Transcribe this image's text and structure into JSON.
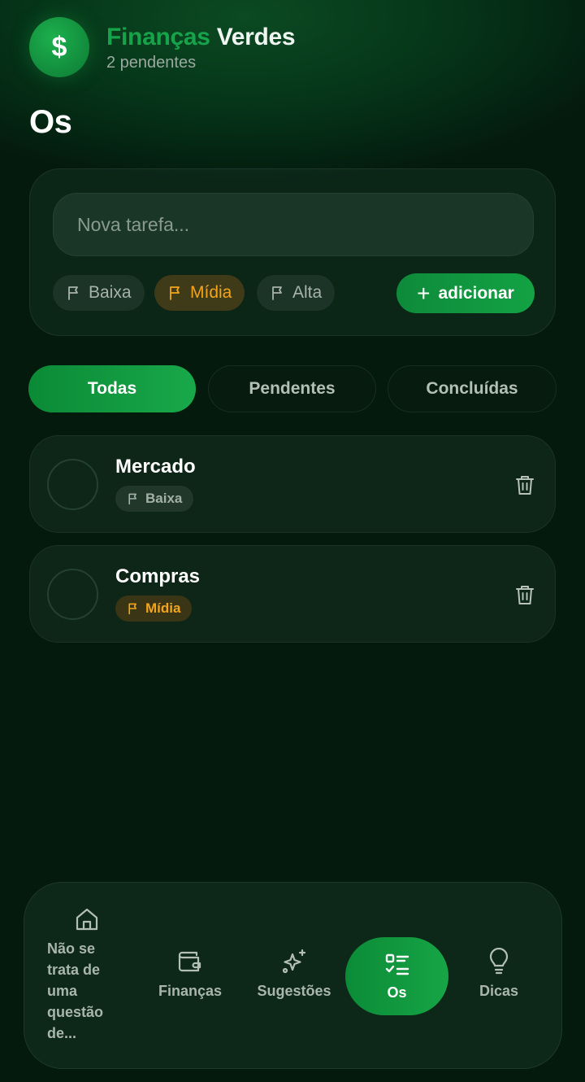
{
  "header": {
    "brand_part1": "Finanças",
    "brand_part2": "Verdes",
    "subtitle": "2 pendentes",
    "logo_icon": "dollar-icon"
  },
  "page_title": "Os",
  "new_task": {
    "placeholder": "Nova tarefa...",
    "priorities": [
      {
        "label": "Baixa",
        "selected": false
      },
      {
        "label": "Mídia",
        "selected": true
      },
      {
        "label": "Alta",
        "selected": false
      }
    ],
    "add_label": "adicionar"
  },
  "filters": [
    {
      "label": "Todas",
      "active": true
    },
    {
      "label": "Pendentes",
      "active": false
    },
    {
      "label": "Concluídas",
      "active": false
    }
  ],
  "tasks": [
    {
      "title": "Mercado",
      "priority": "Baixa",
      "done": false
    },
    {
      "title": "Compras",
      "priority": "Mídia",
      "done": false
    }
  ],
  "nav": {
    "home": "Não se trata de uma questão de...",
    "finances": "Finanças",
    "suggestions": "Sugestões",
    "tasks": "Os",
    "tips": "Dicas"
  },
  "colors": {
    "accent": "#16a34a",
    "priority_medium": "#f2a51c",
    "background": "#031409"
  }
}
